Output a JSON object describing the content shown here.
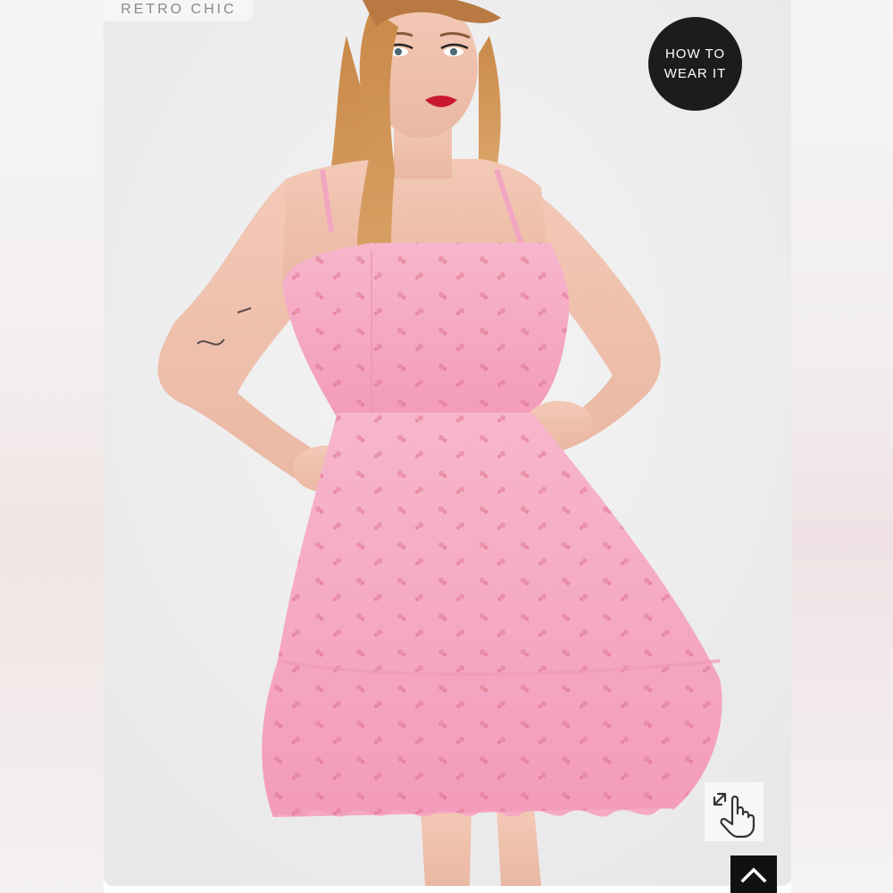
{
  "brand": {
    "label": "RETRO CHIC"
  },
  "how_to_wear": {
    "line1": "HOW TO",
    "line2": "WEAR IT"
  },
  "photo": {
    "subject": "model wearing pink tulle mini dress",
    "dress_color": "#f5a8c4"
  },
  "icons": {
    "zoom": "hand-pointer-expand-icon",
    "scroll_top": "chevron-up-icon"
  },
  "colors": {
    "badge_bg": "#1c1c1c",
    "badge_text": "#ffffff",
    "background": "#ededee"
  }
}
